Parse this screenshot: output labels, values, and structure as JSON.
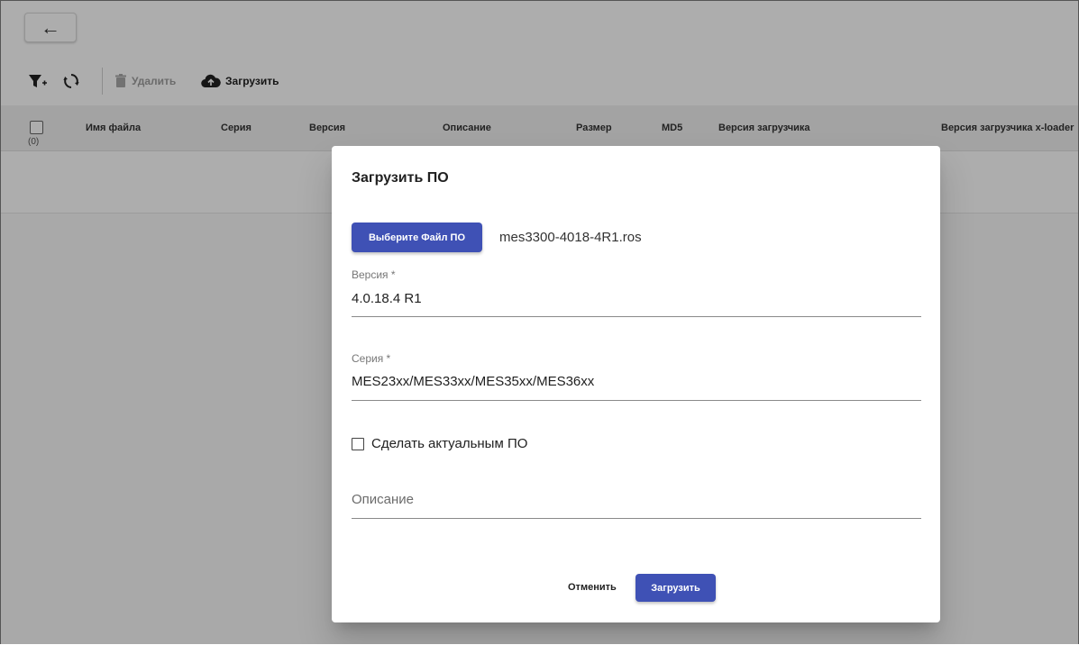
{
  "toolbar": {
    "back_arrow": "←",
    "delete_label": "Удалить",
    "upload_label": "Загрузить"
  },
  "table": {
    "columns": [
      "Имя файла",
      "Серия",
      "Версия",
      "Описание",
      "Размер",
      "MD5",
      "Версия загрузчика",
      "Версия загрузчика  x-loader"
    ],
    "selected_count": "(0)"
  },
  "dialog": {
    "title": "Загрузить ПО",
    "choose_file_label": "Выберите Файл ПО",
    "file_name": "mes3300-4018-4R1.ros",
    "version_label": "Версия *",
    "version_value": "4.0.18.4 R1",
    "series_label": "Серия *",
    "series_value": "MES23xx/MES33xx/MES35xx/MES36xx",
    "make_current_label": "Сделать актуальным ПО",
    "description_placeholder": "Описание",
    "cancel_label": "Отменить",
    "submit_label": "Загрузить"
  },
  "colors": {
    "primary": "#3f51b5",
    "overlay": "rgba(0,0,0,0.32)"
  },
  "icons": [
    "back-arrow-icon",
    "filter-add-icon",
    "refresh-icon",
    "trash-icon",
    "cloud-upload-icon"
  ]
}
